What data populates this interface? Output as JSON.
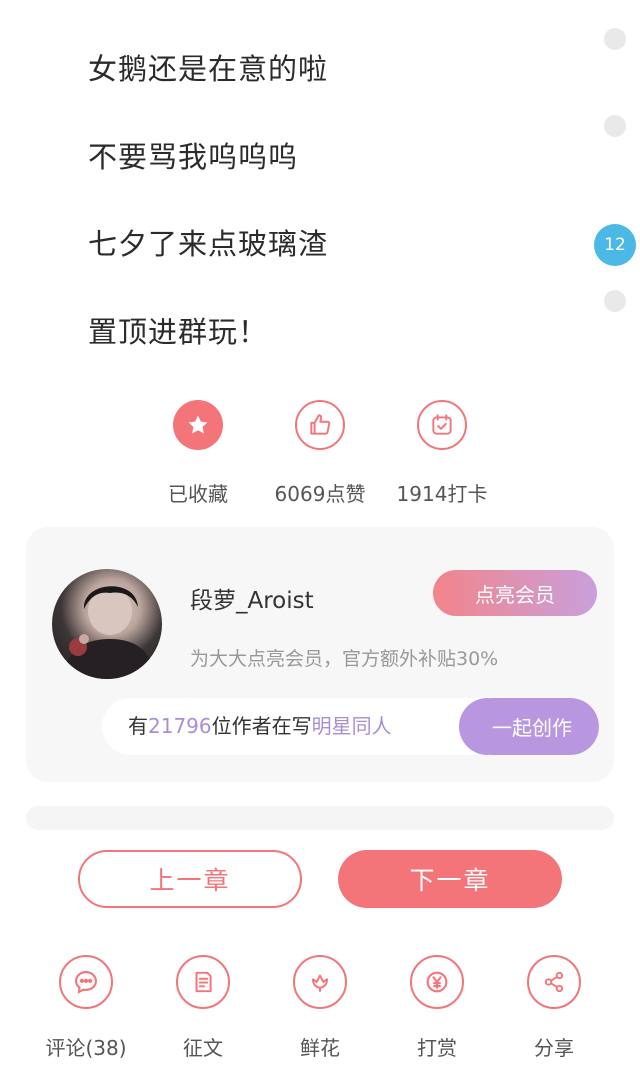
{
  "paragraphs": [
    "女鹅还是在意的啦",
    "不要骂我呜呜呜",
    "七夕了来点玻璃渣",
    "置顶进群玩！"
  ],
  "comment_badge": "12",
  "actions": {
    "collect_label": "已收藏",
    "like_label": "6069点赞",
    "checkin_label": "1914打卡"
  },
  "author": {
    "name": "段萝_Aroist",
    "vip_button": "点亮会员",
    "vip_tip": "为大大点亮会员，官方额外补贴30%",
    "writers_prefix": "有",
    "writers_count": "21796",
    "writers_middle": "位作者在写",
    "writers_genre": "明星同人",
    "create_button": "一起创作"
  },
  "navigation": {
    "prev_label": "上一章",
    "next_label": "下一章"
  },
  "toolbar": {
    "comment_label": "评论(38)",
    "essay_label": "征文",
    "flower_label": "鲜花",
    "reward_label": "打赏",
    "share_label": "分享"
  },
  "colors": {
    "accent": "#f3757a",
    "purple": "#b896e0",
    "badge_blue": "#4bb8e6"
  }
}
